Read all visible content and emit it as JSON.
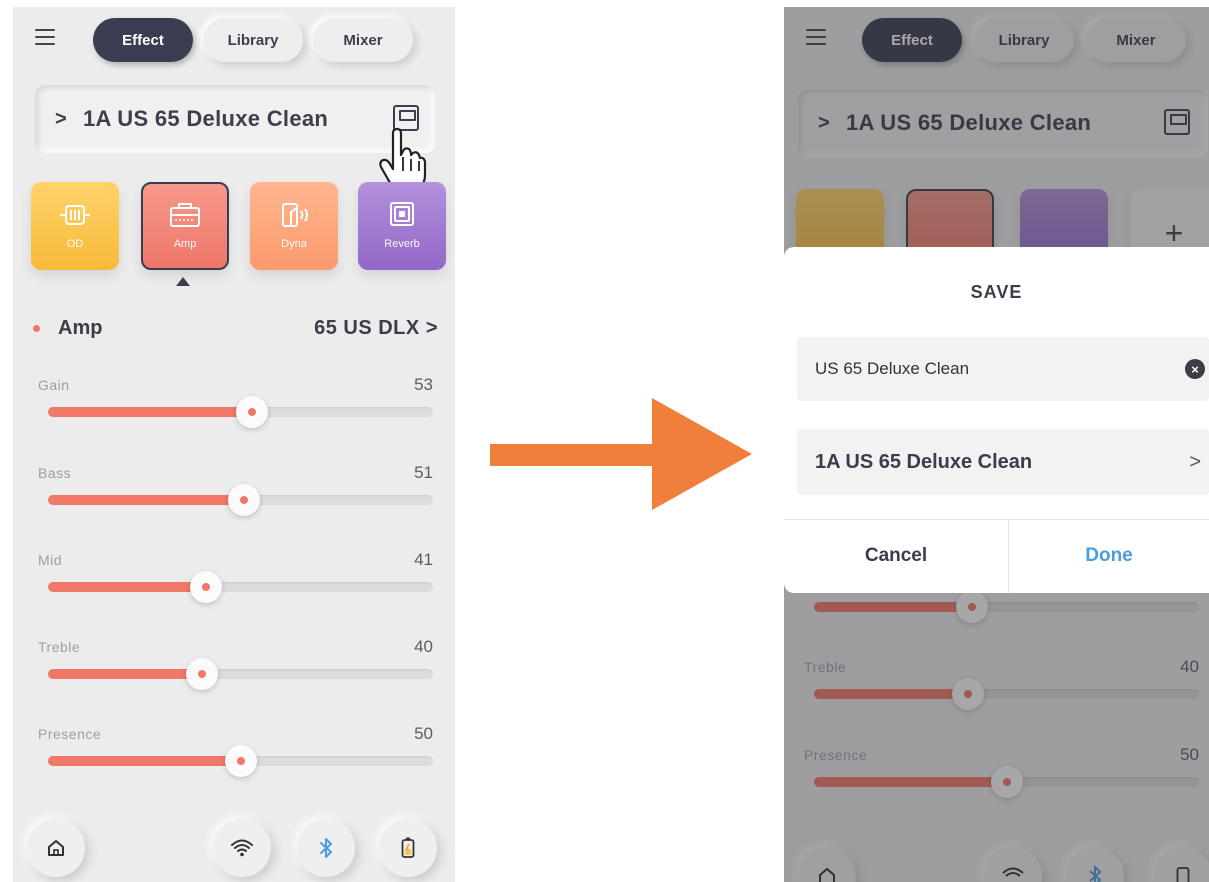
{
  "left": {
    "tabs": [
      {
        "label": "Effect",
        "active": true
      },
      {
        "label": "Library",
        "active": false
      },
      {
        "label": "Mixer",
        "active": false
      }
    ],
    "preset": {
      "chevron": ">",
      "name": "1A  US 65 Deluxe Clean",
      "save_icon": "save-disk-icon"
    },
    "fx_tiles": [
      {
        "label": "OD",
        "color": "#f7b93a"
      },
      {
        "label": "Amp",
        "color": "#ee776a",
        "selected": true
      },
      {
        "label": "Dyna",
        "color": "#fb9a6d"
      },
      {
        "label": "Reverb",
        "color": "#9168c7"
      }
    ],
    "amp": {
      "title": "Amp",
      "model": "65 US DLX",
      "chevron": ">"
    },
    "sliders": [
      {
        "label": "Gain",
        "value": "53",
        "level": 0.53
      },
      {
        "label": "Bass",
        "value": "51",
        "level": 0.51
      },
      {
        "label": "Mid",
        "value": "41",
        "level": 0.41
      },
      {
        "label": "Treble",
        "value": "40",
        "level": 0.4
      },
      {
        "label": "Presence",
        "value": "50",
        "level": 0.5
      }
    ],
    "bottom_icons": [
      "home-icon",
      "wifi-icon",
      "bluetooth-icon",
      "battery-icon"
    ]
  },
  "right": {
    "tabs": [
      {
        "label": "Effect",
        "active": true
      },
      {
        "label": "Library",
        "active": false
      },
      {
        "label": "Mixer",
        "active": false
      }
    ],
    "preset": {
      "chevron": ">",
      "name": "1A  US 65 Deluxe Clean"
    },
    "add_tile": "+",
    "dialog": {
      "title": "SAVE",
      "name_value": "US 65 Deluxe Clean",
      "clear_icon": "×",
      "location": "1A US 65 Deluxe Clean",
      "location_chevron": ">",
      "cancel": "Cancel",
      "done": "Done"
    },
    "sliders": [
      {
        "label": "Mid",
        "value": "41",
        "level": 0.41
      },
      {
        "label": "Treble",
        "value": "40",
        "level": 0.4
      },
      {
        "label": "Presence",
        "value": "50",
        "level": 0.5
      }
    ]
  },
  "colors": {
    "accent": "#ef7868",
    "arrow": "#ef7f3a",
    "done": "#4a9ee0"
  }
}
